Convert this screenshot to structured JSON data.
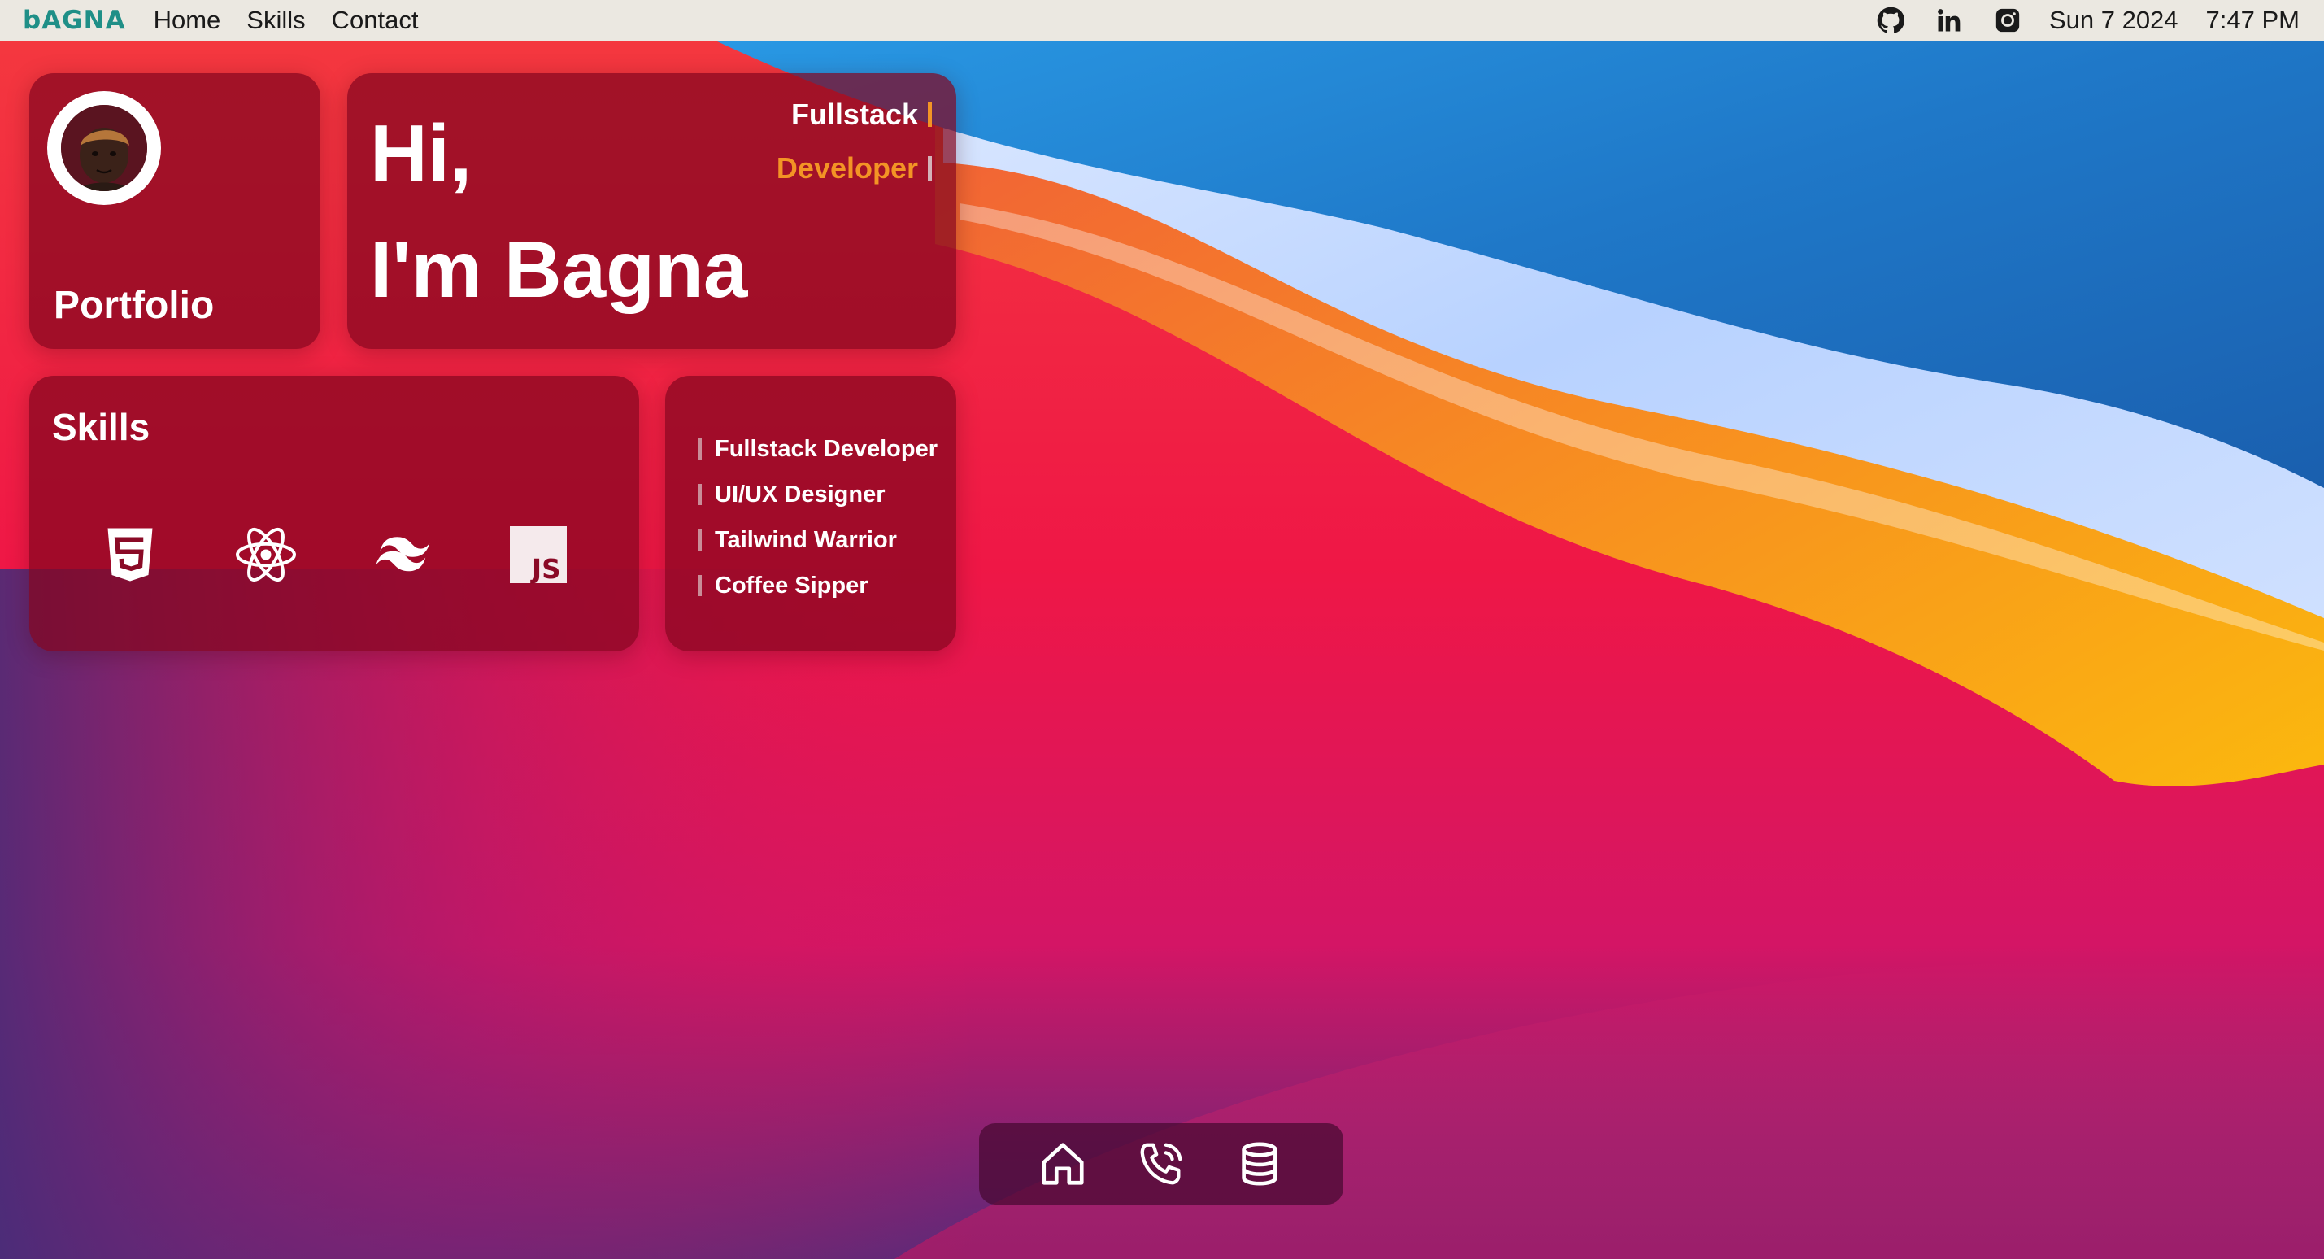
{
  "menubar": {
    "brand": "bAGNA",
    "nav": [
      "Home",
      "Skills",
      "Contact"
    ],
    "tray_icons": [
      "github-icon",
      "linkedin-icon",
      "instagram-icon"
    ],
    "date": "Sun 7 2024",
    "time": "7:47 PM"
  },
  "profile": {
    "label": "Portfolio",
    "avatar": "avatar"
  },
  "hero": {
    "greeting": "Hi,",
    "name": "I'm Bagna",
    "typewriter": [
      "Fullstack",
      "Developer"
    ]
  },
  "skills": {
    "title": "Skills",
    "icons": [
      "html5-icon",
      "react-icon",
      "tailwind-icon",
      "javascript-icon"
    ]
  },
  "roles": {
    "items": [
      "Fullstack Developer",
      "UI/UX Designer",
      "Tailwind Warrior",
      "Coffee Sipper"
    ]
  },
  "dock": {
    "items": [
      "home-icon",
      "phone-icon",
      "database-icon"
    ]
  },
  "colors": {
    "brand": "#1f8f87",
    "accent_orange": "#f39425",
    "card": "#82061e",
    "dock": "#460830"
  }
}
